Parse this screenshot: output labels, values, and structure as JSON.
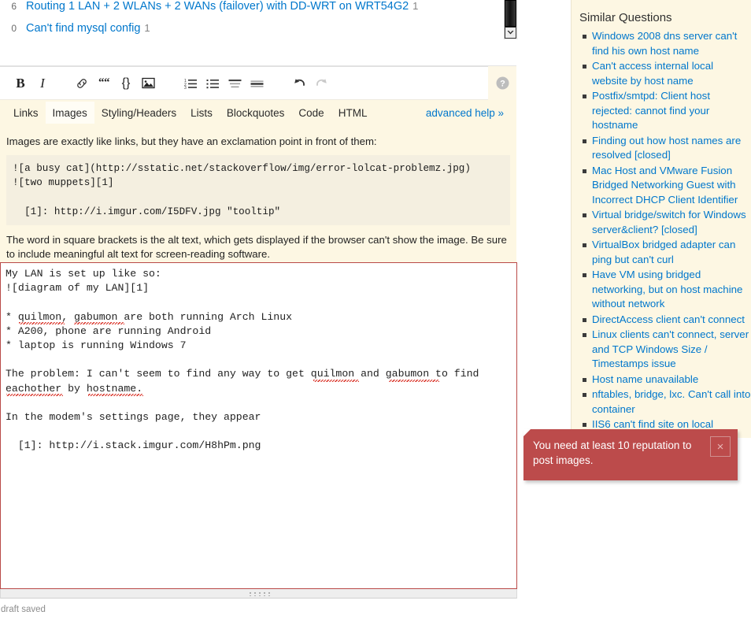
{
  "related_questions": {
    "items": [
      {
        "votes": "6",
        "title": "Routing 1 LAN + 2 WLANs + 2 WANs (failover) with DD-WRT on WRT54G2",
        "answers": "1"
      },
      {
        "votes": "0",
        "title": "Can't find mysql config",
        "answers": "1"
      }
    ]
  },
  "toolbar": {
    "bold": "B",
    "italic": "I",
    "link_icon": "link-icon",
    "quote": "“",
    "code": "{}",
    "image_icon": "image-icon",
    "numbered_list_icon": "numbered-list-icon",
    "bulleted_list_icon": "bulleted-list-icon",
    "heading_icon": "heading-icon",
    "horizontal_rule_icon": "horizontal-rule-icon",
    "undo_icon": "undo-icon",
    "redo_icon": "redo-icon",
    "help_icon": "question-mark-icon"
  },
  "help": {
    "tabs": [
      {
        "label": "Links",
        "active": false
      },
      {
        "label": "Images",
        "active": true
      },
      {
        "label": "Styling/Headers",
        "active": false
      },
      {
        "label": "Lists",
        "active": false
      },
      {
        "label": "Blockquotes",
        "active": false
      },
      {
        "label": "Code",
        "active": false
      },
      {
        "label": "HTML",
        "active": false
      }
    ],
    "advanced_help": "advanced help »",
    "intro": "Images are exactly like links, but they have an exclamation point in front of them:",
    "code_sample": "![a busy cat](http://sstatic.net/stackoverflow/img/error-lolcat-problemz.jpg)\n![two muppets][1]\n\n  [1]: http://i.imgur.com/I5DFV.jpg \"tooltip\"",
    "outro": "The word in square brackets is the alt text, which gets displayed if the browser can't show the image. Be sure to include meaningful alt text for screen-reading software."
  },
  "editor": {
    "body_value": "My LAN is set up like so:\n![diagram of my LAN][1]\n\n* quilmon, gabumon are both running Arch Linux\n* A200, phone are running Android\n* laptop is running Windows 7\n\nThe problem: I can't seem to find any way to get quilmon and gabumon to find\neachother by hostname.\n\nIn the modem's settings page, they appear\n\n  [1]: http://i.stack.imgur.com/H8hPm.png",
    "placeholder": "",
    "draft_status": "draft saved",
    "border_color": "#b94a48"
  },
  "sidebar": {
    "title": "Similar Questions",
    "items": [
      "Windows 2008 dns server can't find his own host name",
      "Can't access internal local website by host name",
      "Postfix/smtpd: Client host rejected: cannot find your hostname",
      "Finding out how host names are resolved [closed]",
      "Mac Host and VMware Fusion Bridged Networking Guest with Incorrect DHCP Client Identifier",
      "Virtual bridge/switch for Windows server&client? [closed]",
      "VirtualBox bridged adapter can ping but can't curl",
      "Have VM using bridged networking, but on host machine without network",
      "DirectAccess client can't connect",
      "Linux clients can't connect, server and TCP Windows Size / Timestamps issue",
      "Host name unavailable",
      "nftables, bridge, lxc. Can't call into container",
      "IIS6 can't find site on local"
    ]
  },
  "notification": {
    "message": "You need at least 10 reputation to post images.",
    "close_label": "×",
    "background_color": "#bc4b4b"
  },
  "colors": {
    "link": "#0077cc",
    "help_background": "#fdf7e3",
    "code_background": "#f4efe0",
    "error_red": "#b94a48"
  }
}
